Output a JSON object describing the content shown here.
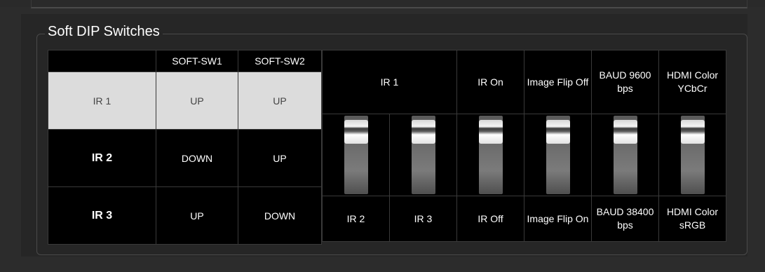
{
  "section": {
    "title": "Soft DIP Switches"
  },
  "table": {
    "headers": [
      "",
      "SOFT-SW1",
      "SOFT-SW2"
    ],
    "rows": [
      {
        "label": "IR 1",
        "sw1": "UP",
        "sw2": "UP",
        "selected": true
      },
      {
        "label": "IR 2",
        "sw1": "DOWN",
        "sw2": "UP",
        "selected": false
      },
      {
        "label": "IR 3",
        "sw1": "UP",
        "sw2": "DOWN",
        "selected": false
      }
    ]
  },
  "switches": {
    "top_labels": {
      "ir_pair": "IR 1",
      "ir_mode": "IR On",
      "image_flip": "Image Flip Off",
      "baud": "BAUD 9600 bps",
      "hdmi": "HDMI Color YCbCr"
    },
    "bottom_labels": [
      "IR 2",
      "IR 3",
      "IR Off",
      "Image Flip On",
      "BAUD 38400 bps",
      "HDMI Color sRGB"
    ],
    "positions": [
      "up",
      "up",
      "up",
      "up",
      "up",
      "up"
    ]
  },
  "colors": {
    "background": "#2b2b2b",
    "cell": "#000000",
    "selected_row": "#dcdcdc"
  }
}
